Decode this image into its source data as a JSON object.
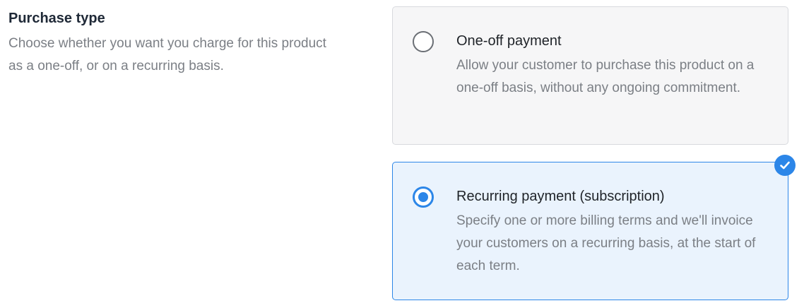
{
  "section": {
    "title": "Purchase type",
    "description": "Choose whether you want you charge for this product as a one-off, or on a recurring basis."
  },
  "options": [
    {
      "title": "One-off payment",
      "description": "Allow your customer to purchase this product on a one-off basis, without any ongoing commitment.",
      "selected": false
    },
    {
      "title": "Recurring payment (subscription)",
      "description": "Specify one or more billing terms and we'll invoice your customers on a recurring basis, at the start of each term.",
      "selected": true
    }
  ],
  "colors": {
    "accent": "#2c86e8",
    "selected_bg": "#eaf3fd",
    "unselected_bg": "#f6f6f7",
    "muted_text": "#7b7f85"
  },
  "icons": {
    "selected_badge": "checkmark-circle-icon"
  }
}
